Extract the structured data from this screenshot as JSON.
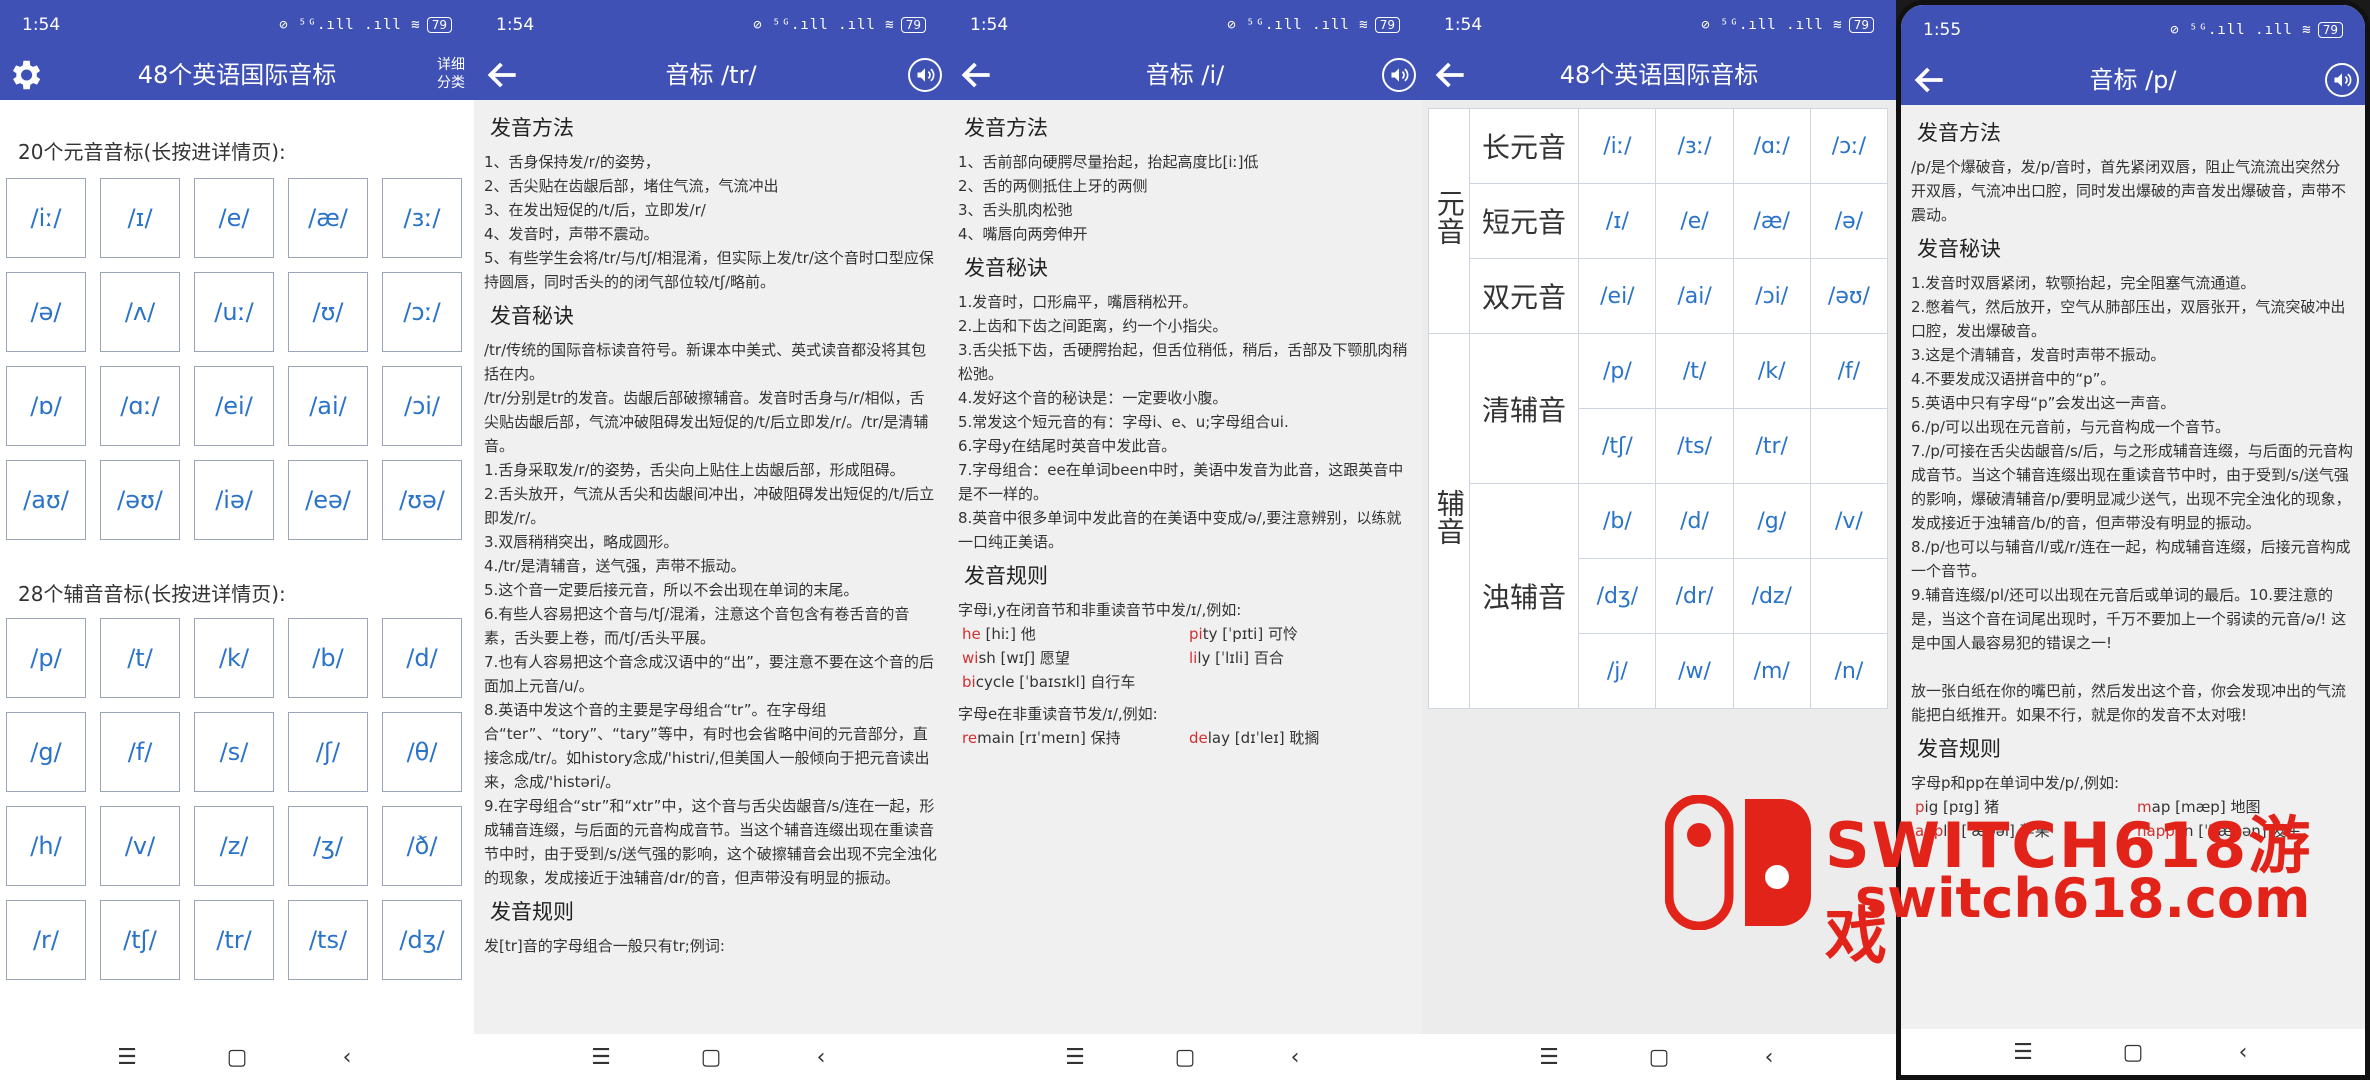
{
  "status": {
    "time1": "1:54",
    "time2": "1:54",
    "time3": "1:54",
    "time4": "1:54",
    "time5": "1:55",
    "icons": "⊘ ⁵ᴳ.ıll .ıll ≋",
    "battery": "79"
  },
  "screen1": {
    "title": "48个英语国际音标",
    "detail": "详细分类",
    "vowel_title": "20个元音音标(长按进详情页):",
    "vowels": [
      "/iː/",
      "/ɪ/",
      "/e/",
      "/æ/",
      "/ɜː/",
      "/ə/",
      "/ʌ/",
      "/uː/",
      "/ʊ/",
      "/ɔː/",
      "/ɒ/",
      "/ɑː/",
      "/ei/",
      "/ai/",
      "/ɔi/",
      "/aʊ/",
      "/əʊ/",
      "/iə/",
      "/eə/",
      "/ʊə/"
    ],
    "consonant_title": "28个辅音音标(长按进详情页):",
    "consonants": [
      "/p/",
      "/t/",
      "/k/",
      "/b/",
      "/d/",
      "/g/",
      "/f/",
      "/s/",
      "/ʃ/",
      "/θ/",
      "/h/",
      "/v/",
      "/z/",
      "/ʒ/",
      "/ð/",
      "/r/",
      "/tʃ/",
      "/tr/",
      "/ts/",
      "/dʒ/"
    ]
  },
  "screen2": {
    "title": "音标 /tr/",
    "h_method": "发音方法",
    "method": [
      "1、舌身保持发/r/的姿势，",
      "2、舌尖贴在齿龈后部，堵住气流，气流冲出",
      "3、在发出短促的/t/后，立即发/r/",
      "4、发音时，声带不震动。",
      "5、有些学生会将/tr/与/tʃ/相混淆，但实际上发/tr/这个音时口型应保持圆唇，同时舌头的的闭气部位较/tʃ/略前。"
    ],
    "h_tips": "发音秘诀",
    "tips": [
      "/tr/传统的国际音标读音符号。新课本中美式、英式读音都没将其包括在内。",
      "/tr/分别是tr的发音。齿龈后部破擦辅音。发音时舌身与/r/相似，舌尖贴齿龈后部，气流冲破阻碍发出短促的/t/后立即发/r/。/tr/是清辅音。",
      "1.舌身采取发/r/的姿势，舌尖向上贴住上齿龈后部，形成阻碍。",
      "2.舌头放开，气流从舌尖和齿龈间冲出，冲破阻碍发出短促的/t/后立即发/r/。",
      "3.双唇稍稍突出，略成圆形。",
      "4./tr/是清辅音，送气强，声带不振动。",
      "5.这个音一定要后接元音，所以不会出现在单词的末尾。",
      "6.有些人容易把这个音与/tʃ/混淆，注意这个音包含有卷舌音的音素，舌头要上卷，而/tʃ/舌头平展。",
      "7.也有人容易把这个音念成汉语中的“出”，要注意不要在这个音的后面加上元音/u/。",
      "8.英语中发这个音的主要是字母组合“tr”。在字母组合“ter”、“tory”、“tary”等中，有时也会省略中间的元音部分，直接念成/tr/。如history念成/'histri/,但美国人一般倾向于把元音读出来，念成/'histəri/。",
      "9.在字母组合“str”和“xtr”中，这个音与舌尖齿龈音/s/连在一起，形成辅音连缀，与后面的元音构成音节。当这个辅音连缀出现在重读音节中时，由于受到/s/送气强的影响，这个破擦辅音会出现不完全浊化的现象，发成接近于浊辅音/dr/的音，但声带没有明显的振动。"
    ],
    "h_rules": "发音规则",
    "rules": "发[tr]音的字母组合一般只有tr;例词:"
  },
  "screen3": {
    "title": "音标 /i/",
    "h_method": "发音方法",
    "method": [
      "1、舌前部向硬腭尽量抬起，抬起高度比[iː]低",
      "2、舌的两侧抵住上牙的两侧",
      "3、舌头肌肉松弛",
      "4、嘴唇向两旁伸开"
    ],
    "h_tips": "发音秘诀",
    "tips": [
      "1.发音时，口形扁平，嘴唇稍松开。",
      "2.上齿和下齿之间距离，约一个小指尖。",
      "3.舌尖抵下齿，舌硬腭抬起，但舌位稍低，稍后，舌部及下颚肌肉稍松弛。",
      "4.发好这个音的秘诀是：一定要收小腹。",
      "5.常发这个短元音的有：字母i、e、u;字母组合ui.",
      "6.字母y在结尾时英音中发此音。",
      "7.字母组合：ee在单词been中时，美语中发音为此音，这跟英音中是不一样的。",
      "8.英音中很多单词中发此音的在美语中变成/ə/,要注意辨别，以练就一口纯正美语。"
    ],
    "h_rules": "发音规则",
    "rule1": "字母i,y在闭音节和非重读音节中发/ɪ/,例如:",
    "ex1": [
      {
        "hl": "he",
        "rest": " [hiː] 他"
      },
      {
        "hl": "pi",
        "rest": "ty [ˈpɪti] 可怜"
      },
      {
        "hl": "wi",
        "rest": "sh [wɪʃ] 愿望"
      },
      {
        "hl": "li",
        "rest": "ly [ˈlɪli] 百合"
      },
      {
        "hl": "bi",
        "rest": "cycle [ˈbaɪsɪkl] 自行车"
      }
    ],
    "rule2": "字母e在非重读音节发/ɪ/,例如:",
    "ex2": [
      {
        "hl": "re",
        "rest": "main [rɪˈmeɪn] 保持"
      },
      {
        "hl": "de",
        "rest": "lay [dɪˈleɪ] 耽搁"
      }
    ]
  },
  "screen4": {
    "title": "48个英语国际音标",
    "g_vowel": "元音",
    "g_cons": "辅音",
    "long": "长元音",
    "long_ph": [
      "/iː/",
      "/ɜː/",
      "/ɑː/",
      "/ɔː/"
    ],
    "short": "短元音",
    "short_ph": [
      "/ɪ/",
      "/e/",
      "/æ/",
      "/ə/"
    ],
    "diph": "双元音",
    "diph_ph": [
      "/ei/",
      "/ai/",
      "/ɔi/",
      "/əʊ/"
    ],
    "vl": "清辅音",
    "vl_ph1": [
      "/p/",
      "/t/",
      "/k/",
      "/f/"
    ],
    "vl_ph2": [
      "/tʃ/",
      "/ts/",
      "/tr/",
      ""
    ],
    "vd": "浊辅音",
    "vd_ph1": [
      "/b/",
      "/d/",
      "/g/",
      "/v/"
    ],
    "vd_ph2": [
      "/dʒ/",
      "/dr/",
      "/dz/",
      ""
    ],
    "vd_ph3": [
      "/j/",
      "/w/",
      "/m/",
      "/n/"
    ]
  },
  "screen5": {
    "title": "音标 /p/",
    "h_method": "发音方法",
    "method": "/p/是个爆破音，发/p/音时，首先紧闭双唇，阻止气流流出突然分开双唇，气流冲出口腔，同时发出爆破的声音发出爆破音，声带不震动。",
    "h_tips": "发音秘诀",
    "tips": [
      "1.发音时双唇紧闭，软颚抬起，完全阻塞气流通道。",
      "2.憋着气，然后放开，空气从肺部压出，双唇张开，气流突破冲出口腔，发出爆破音。",
      "3.这是个清辅音，发音时声带不振动。",
      "4.不要发成汉语拼音中的“p”。",
      "5.英语中只有字母“p”会发出这一声音。",
      "6./p/可以出现在元音前，与元音构成一个音节。",
      "7./p/可接在舌尖齿龈音/s/后，与之形成辅音连缀，与后面的元音构成音节。当这个辅音连缀出现在重读音节中时，由于受到/s/送气强的影响，爆破清辅音/p/要明显减少送气，出现不完全浊化的现象，发成接近于浊辅音/b/的音，但声带没有明显的振动。",
      "8./p/也可以与辅音/l/或/r/连在一起，构成辅音连缀，后接元音构成一个音节。",
      "9.辅音连缀/pl/还可以出现在元音后或单词的最后。10.要注意的是，当这个音在词尾出现时，千万不要加上一个弱读的元音/ə/! 这是中国人最容易犯的错误之一!",
      "",
      "放一张白纸在你的嘴巴前，然后发出这个音，你会发现冲出的气流能把白纸推开。如果不行，就是你的发音不太对哦!"
    ],
    "h_rules": "发音规则",
    "rule1": "字母p和pp在单词中发/p/,例如:",
    "ex": [
      {
        "hl": "p",
        "rest": "ig [pɪg] 猪"
      },
      {
        "hl": "m",
        "rest": "ap [mæp] 地图"
      },
      {
        "hl": "app",
        "rest": "le [ˈæpəl] 苹果"
      },
      {
        "hl": "happ",
        "rest": "en [ˈhæpən] 发生"
      }
    ]
  },
  "watermark": {
    "brand": "SWITCH618游戏",
    "url": "switch618.com"
  },
  "colors": {
    "accent": "#3F51B5",
    "phonetic": "#2a73c8",
    "highlight": "#d32f2f"
  }
}
